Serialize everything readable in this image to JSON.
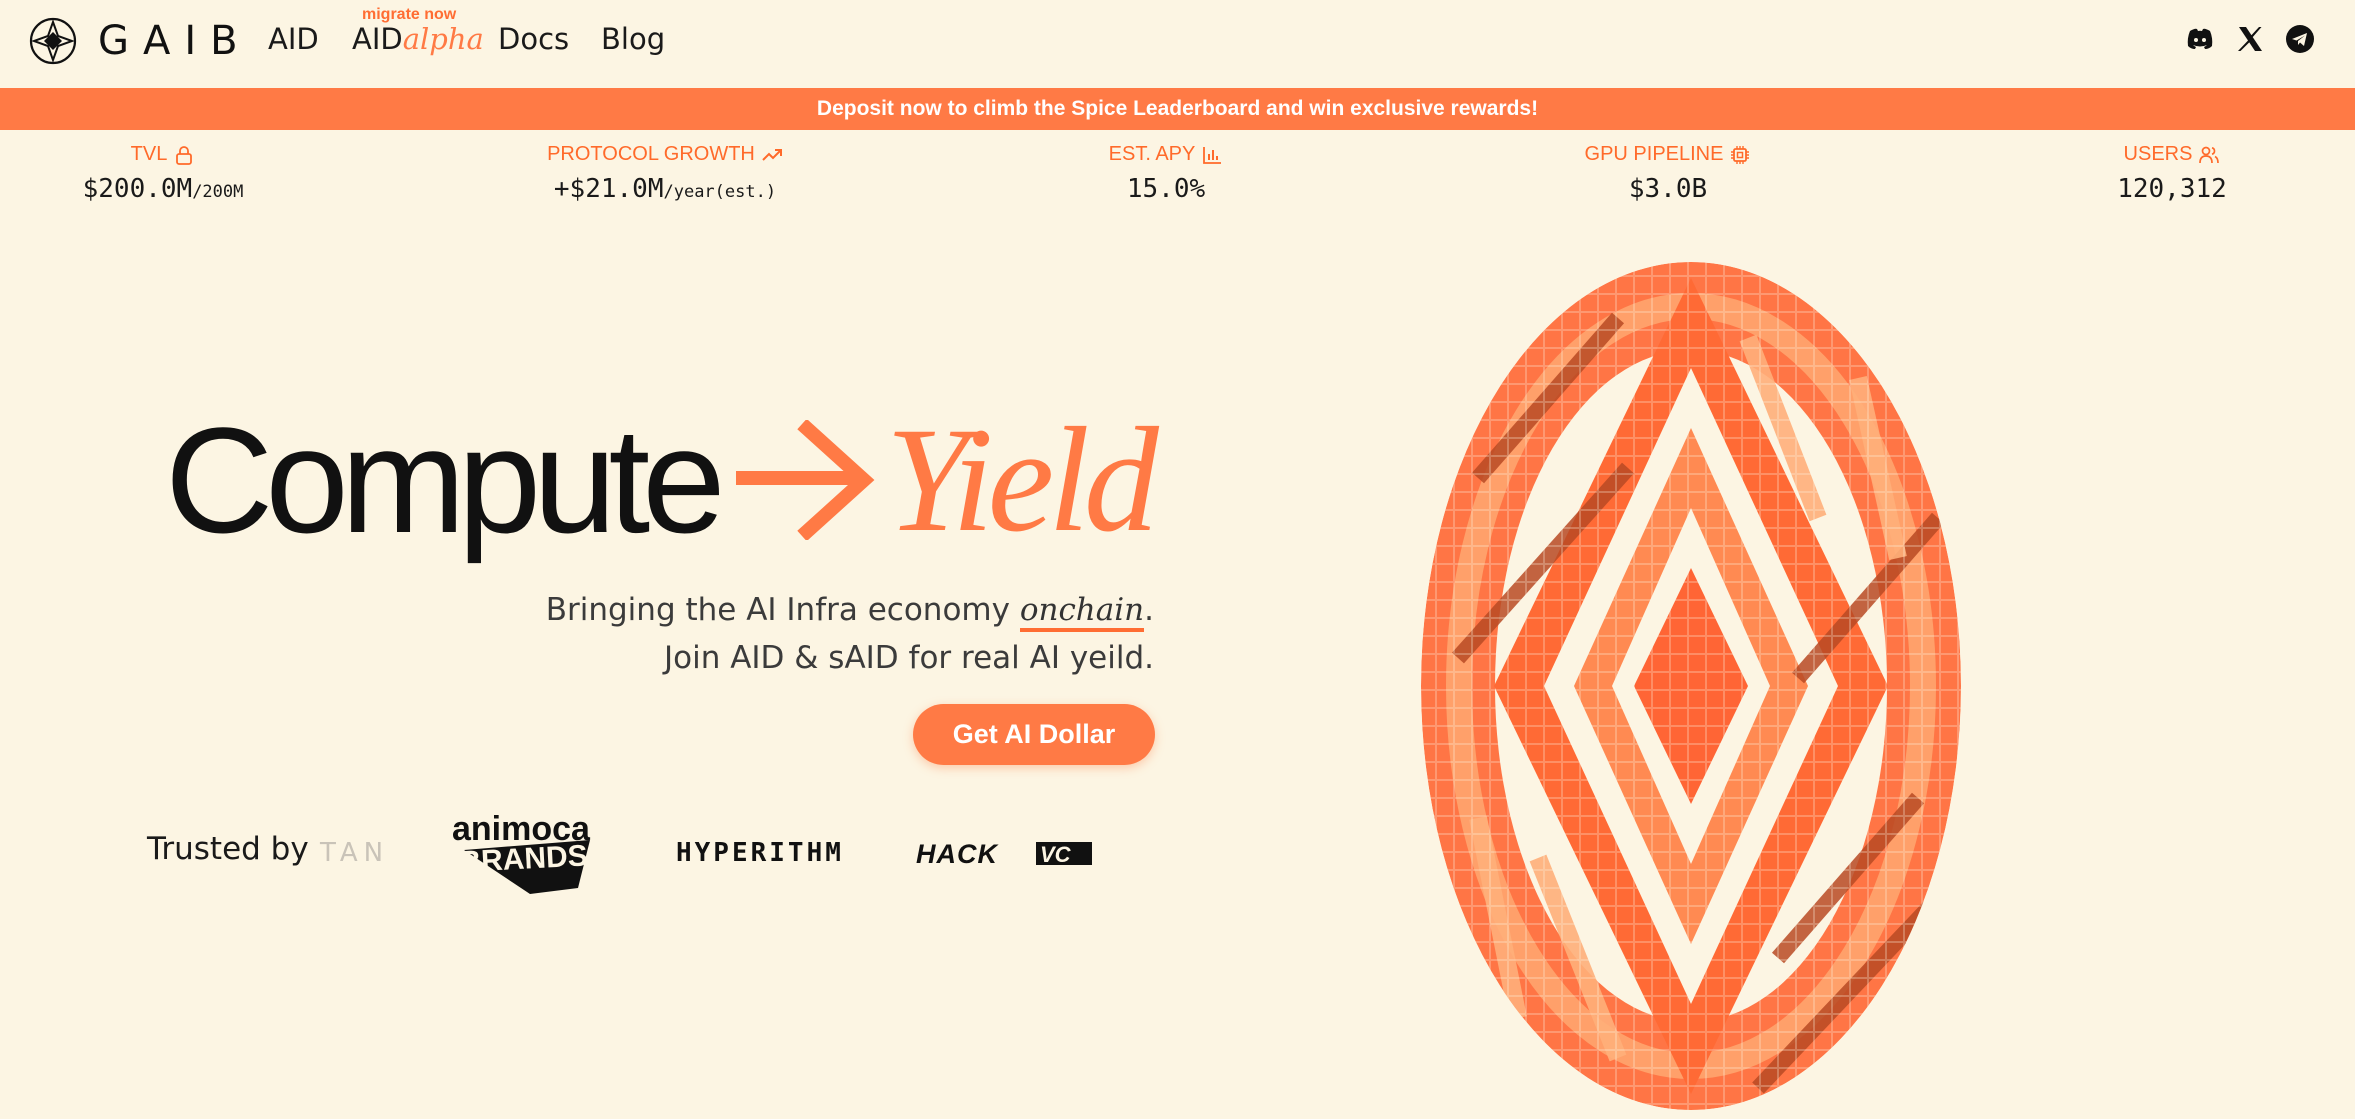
{
  "nav": {
    "brand": "GAIB",
    "links": {
      "aid": "AID",
      "aidalpha_prefix": "AID",
      "aidalpha_suffix": "alpha",
      "docs": "Docs",
      "blog": "Blog"
    },
    "migrate_badge": "migrate now",
    "socials": [
      "discord-icon",
      "x-icon",
      "telegram-icon"
    ]
  },
  "banner": {
    "text": "Deposit now to climb the Spice Leaderboard and win exclusive rewards!"
  },
  "stats": {
    "tvl": {
      "label": "TVL",
      "icon": "lock-icon",
      "value": "$200.0M",
      "unit": "/200M"
    },
    "growth": {
      "label": "PROTOCOL GROWTH",
      "icon": "trending-up-icon",
      "value": "+$21.0M",
      "unit": "/year(est.)"
    },
    "apy": {
      "label": "EST. APY",
      "icon": "bar-chart-icon",
      "value": "15.0%"
    },
    "gpu": {
      "label": "GPU PIPELINE",
      "icon": "chip-icon",
      "value": "$3.0B"
    },
    "users": {
      "label": "USERS",
      "icon": "users-icon",
      "value": "120,312"
    }
  },
  "hero": {
    "word1": "Compute",
    "word2": "Yield",
    "sub_line1_before": "Bringing the AI Infra economy ",
    "sub_line1_em": "onchain",
    "sub_line1_after": ".",
    "sub_line2": "Join AID & sAID for real AI yeild.",
    "cta": "Get AI Dollar"
  },
  "trusted": {
    "label": "Trusted by",
    "partners": {
      "tan": "TAN",
      "animoca_1": "animoca",
      "animoca_2": "BRANDS",
      "hyperithm": "HYPERITHM",
      "hack": "HACKVC"
    }
  },
  "colors": {
    "accent": "#ff7a45",
    "background": "#fcf5e3",
    "text": "#1a1a1a"
  }
}
